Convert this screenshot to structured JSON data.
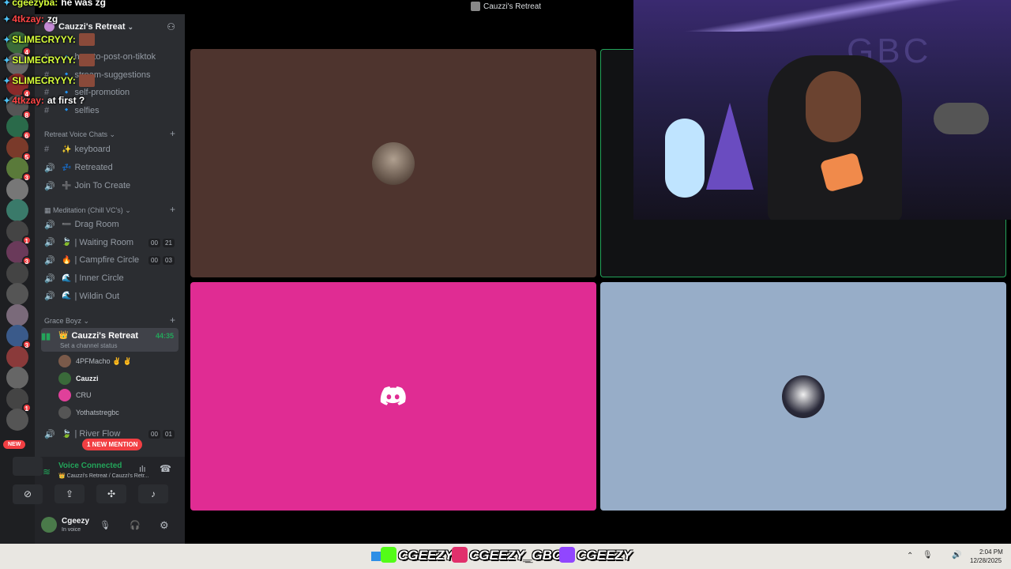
{
  "window": {
    "title": "Cauzzi's Retreat"
  },
  "server": {
    "name": "Cauzzi's Retreat"
  },
  "overlay_chat": [
    {
      "user": "cgeezyba",
      "msg": "he was zg",
      "color": "#d7ff3a"
    },
    {
      "user": "4tkzay",
      "msg": "zg",
      "color": "#ff4545"
    },
    {
      "user": "SLIMECRYYY",
      "msg": "",
      "color": "#d7ff3a"
    },
    {
      "user": "SLIMECRYYY",
      "msg": "",
      "color": "#d7ff3a"
    },
    {
      "user": "SLIMECRYYY",
      "msg": "",
      "color": "#d7ff3a"
    },
    {
      "user": "4tkzay",
      "msg": "at first ?",
      "color": "#ff4545"
    }
  ],
  "text_channels": [
    {
      "label": "how-to-post-on-tiktok"
    },
    {
      "label": "stream-suggestions"
    },
    {
      "label": "self-promotion"
    },
    {
      "label": "selfies"
    }
  ],
  "categories": {
    "retreat_voice": "Retreat Voice Chats",
    "meditation": "Meditation (Chill VC's)",
    "grace_boyz": "Grace Boyz"
  },
  "retreat_voice_channels": [
    {
      "label": "keyboard",
      "emoji": "✨"
    },
    {
      "label": "Retreated",
      "emoji": "💤"
    },
    {
      "label": "Join To Create",
      "emoji": "➕"
    }
  ],
  "meditation_channels": [
    {
      "label": "Drag Room",
      "emoji": "➖"
    },
    {
      "label": "| Waiting Room",
      "emoji": "🍃",
      "c1": "00",
      "c2": "21"
    },
    {
      "label": "| Campfire Circle",
      "emoji": "🔥",
      "c1": "00",
      "c2": "03"
    },
    {
      "label": "| Inner Circle",
      "emoji": "🌊"
    },
    {
      "label": "| Wildin Out",
      "emoji": "🌊"
    }
  ],
  "active_channel": {
    "label": "Cauzzi's Retreat",
    "emoji": "👑",
    "timer": "44:35",
    "status": "Set a channel status"
  },
  "voice_users": [
    {
      "name": "4PFMacho ✌️ ✌️"
    },
    {
      "name": "Cauzzi"
    },
    {
      "name": "CRU"
    },
    {
      "name": "Yothatstregbc"
    }
  ],
  "river_flow": {
    "label": "| River Flow",
    "c1": "00",
    "c2": "01"
  },
  "mention_pill": "1 NEW MENTION",
  "new_pill": "NEW",
  "guild_badges": [
    "4",
    "",
    "4",
    "8",
    "6",
    "5",
    "3",
    "",
    "",
    "1",
    "3",
    "",
    "",
    "",
    "3",
    "",
    "",
    "1",
    ""
  ],
  "voice_panel": {
    "status": "Voice Connected",
    "location": "👑 Cauzzi's Retreat / Cauzzi's Retr..."
  },
  "user_panel": {
    "name": "Cgeezy",
    "status": "In voice"
  },
  "socials": [
    {
      "handle": "CGEEZY",
      "icon": "kick-icon",
      "color": "#53fc18"
    },
    {
      "handle": "CGEEZY_GBC",
      "icon": "instagram-icon",
      "color": "#e1306c"
    },
    {
      "handle": "CGEEZY",
      "icon": "twitch-icon",
      "color": "#9146ff"
    }
  ],
  "tray": {
    "time": "2:04 PM",
    "date": "12/28/2025"
  },
  "tiles": [
    {
      "name": "tile-user-brown",
      "color": "#4e342e"
    },
    {
      "name": "tile-camera",
      "color": "#111214"
    },
    {
      "name": "tile-discord",
      "color": "#e02c93"
    },
    {
      "name": "tile-user-blue",
      "color": "#97adc8"
    }
  ]
}
